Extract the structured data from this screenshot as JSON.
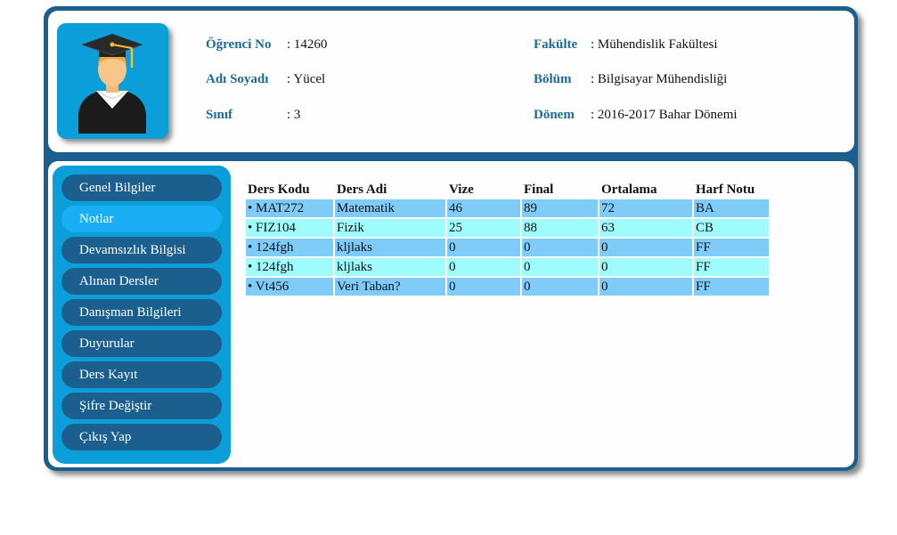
{
  "student": {
    "no_label": "Öğrenci No",
    "no_value": ": 14260",
    "name_label": "Adı Soyadı",
    "name_value": ": Yücel",
    "class_label": "Sınıf",
    "class_value": ": 3",
    "faculty_label": "Fakülte",
    "faculty_value": ": Mühendislik Fakültesi",
    "dept_label": "Bölüm",
    "dept_value": ": Bilgisayar Mühendisliği",
    "term_label": "Dönem",
    "term_value": ": 2016-2017 Bahar Dönemi"
  },
  "menu": {
    "items": [
      {
        "label": "Genel Bilgiler"
      },
      {
        "label": "Notlar",
        "active": true
      },
      {
        "label": "Devamsızlık Bilgisi"
      },
      {
        "label": "Alınan Dersler"
      },
      {
        "label": "Danışman Bilgileri"
      },
      {
        "label": "Duyurular"
      },
      {
        "label": "Ders Kayıt"
      },
      {
        "label": "Şifre Değiştir"
      },
      {
        "label": "Çıkış Yap"
      }
    ]
  },
  "grades": {
    "headers": [
      "Ders Kodu",
      "Ders Adi",
      "Vize",
      "Final",
      "Ortalama",
      "Harf Notu"
    ],
    "rows": [
      [
        "• MAT272",
        "Matematik",
        "46",
        "89",
        "72",
        "BA"
      ],
      [
        "• FIZ104",
        "Fizik",
        "25",
        "88",
        "63",
        "CB"
      ],
      [
        "• 124fgh",
        "kljlaks",
        "0",
        "0",
        "0",
        "FF"
      ],
      [
        "• 124fgh",
        "kljlaks",
        "0",
        "0",
        "0",
        "FF"
      ],
      [
        "• Vt456",
        "Veri Taban?",
        "0",
        "0",
        "0",
        "FF"
      ]
    ]
  },
  "colors": {
    "frame": "#1a5f8e",
    "sidebar": "#0b9ed8",
    "menu_item": "#1a5f8e",
    "menu_active": "#1aaff5",
    "label_text": "#1c6a9a",
    "row_blue": "#80ccf9",
    "row_cyan": "#9ffcfc"
  },
  "icons": {
    "avatar": "graduate-avatar-icon"
  }
}
